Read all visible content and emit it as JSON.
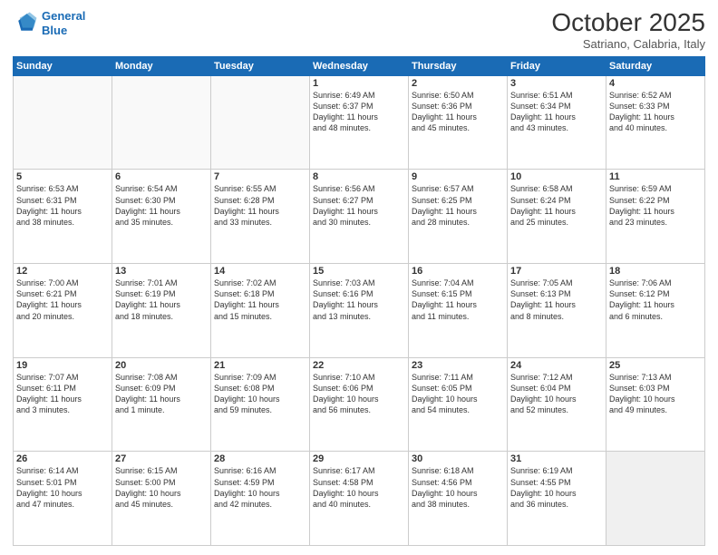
{
  "header": {
    "logo_line1": "General",
    "logo_line2": "Blue",
    "month": "October 2025",
    "location": "Satriano, Calabria, Italy"
  },
  "days_of_week": [
    "Sunday",
    "Monday",
    "Tuesday",
    "Wednesday",
    "Thursday",
    "Friday",
    "Saturday"
  ],
  "weeks": [
    [
      {
        "day": "",
        "info": ""
      },
      {
        "day": "",
        "info": ""
      },
      {
        "day": "",
        "info": ""
      },
      {
        "day": "1",
        "info": "Sunrise: 6:49 AM\nSunset: 6:37 PM\nDaylight: 11 hours\nand 48 minutes."
      },
      {
        "day": "2",
        "info": "Sunrise: 6:50 AM\nSunset: 6:36 PM\nDaylight: 11 hours\nand 45 minutes."
      },
      {
        "day": "3",
        "info": "Sunrise: 6:51 AM\nSunset: 6:34 PM\nDaylight: 11 hours\nand 43 minutes."
      },
      {
        "day": "4",
        "info": "Sunrise: 6:52 AM\nSunset: 6:33 PM\nDaylight: 11 hours\nand 40 minutes."
      }
    ],
    [
      {
        "day": "5",
        "info": "Sunrise: 6:53 AM\nSunset: 6:31 PM\nDaylight: 11 hours\nand 38 minutes."
      },
      {
        "day": "6",
        "info": "Sunrise: 6:54 AM\nSunset: 6:30 PM\nDaylight: 11 hours\nand 35 minutes."
      },
      {
        "day": "7",
        "info": "Sunrise: 6:55 AM\nSunset: 6:28 PM\nDaylight: 11 hours\nand 33 minutes."
      },
      {
        "day": "8",
        "info": "Sunrise: 6:56 AM\nSunset: 6:27 PM\nDaylight: 11 hours\nand 30 minutes."
      },
      {
        "day": "9",
        "info": "Sunrise: 6:57 AM\nSunset: 6:25 PM\nDaylight: 11 hours\nand 28 minutes."
      },
      {
        "day": "10",
        "info": "Sunrise: 6:58 AM\nSunset: 6:24 PM\nDaylight: 11 hours\nand 25 minutes."
      },
      {
        "day": "11",
        "info": "Sunrise: 6:59 AM\nSunset: 6:22 PM\nDaylight: 11 hours\nand 23 minutes."
      }
    ],
    [
      {
        "day": "12",
        "info": "Sunrise: 7:00 AM\nSunset: 6:21 PM\nDaylight: 11 hours\nand 20 minutes."
      },
      {
        "day": "13",
        "info": "Sunrise: 7:01 AM\nSunset: 6:19 PM\nDaylight: 11 hours\nand 18 minutes."
      },
      {
        "day": "14",
        "info": "Sunrise: 7:02 AM\nSunset: 6:18 PM\nDaylight: 11 hours\nand 15 minutes."
      },
      {
        "day": "15",
        "info": "Sunrise: 7:03 AM\nSunset: 6:16 PM\nDaylight: 11 hours\nand 13 minutes."
      },
      {
        "day": "16",
        "info": "Sunrise: 7:04 AM\nSunset: 6:15 PM\nDaylight: 11 hours\nand 11 minutes."
      },
      {
        "day": "17",
        "info": "Sunrise: 7:05 AM\nSunset: 6:13 PM\nDaylight: 11 hours\nand 8 minutes."
      },
      {
        "day": "18",
        "info": "Sunrise: 7:06 AM\nSunset: 6:12 PM\nDaylight: 11 hours\nand 6 minutes."
      }
    ],
    [
      {
        "day": "19",
        "info": "Sunrise: 7:07 AM\nSunset: 6:11 PM\nDaylight: 11 hours\nand 3 minutes."
      },
      {
        "day": "20",
        "info": "Sunrise: 7:08 AM\nSunset: 6:09 PM\nDaylight: 11 hours\nand 1 minute."
      },
      {
        "day": "21",
        "info": "Sunrise: 7:09 AM\nSunset: 6:08 PM\nDaylight: 10 hours\nand 59 minutes."
      },
      {
        "day": "22",
        "info": "Sunrise: 7:10 AM\nSunset: 6:06 PM\nDaylight: 10 hours\nand 56 minutes."
      },
      {
        "day": "23",
        "info": "Sunrise: 7:11 AM\nSunset: 6:05 PM\nDaylight: 10 hours\nand 54 minutes."
      },
      {
        "day": "24",
        "info": "Sunrise: 7:12 AM\nSunset: 6:04 PM\nDaylight: 10 hours\nand 52 minutes."
      },
      {
        "day": "25",
        "info": "Sunrise: 7:13 AM\nSunset: 6:03 PM\nDaylight: 10 hours\nand 49 minutes."
      }
    ],
    [
      {
        "day": "26",
        "info": "Sunrise: 6:14 AM\nSunset: 5:01 PM\nDaylight: 10 hours\nand 47 minutes."
      },
      {
        "day": "27",
        "info": "Sunrise: 6:15 AM\nSunset: 5:00 PM\nDaylight: 10 hours\nand 45 minutes."
      },
      {
        "day": "28",
        "info": "Sunrise: 6:16 AM\nSunset: 4:59 PM\nDaylight: 10 hours\nand 42 minutes."
      },
      {
        "day": "29",
        "info": "Sunrise: 6:17 AM\nSunset: 4:58 PM\nDaylight: 10 hours\nand 40 minutes."
      },
      {
        "day": "30",
        "info": "Sunrise: 6:18 AM\nSunset: 4:56 PM\nDaylight: 10 hours\nand 38 minutes."
      },
      {
        "day": "31",
        "info": "Sunrise: 6:19 AM\nSunset: 4:55 PM\nDaylight: 10 hours\nand 36 minutes."
      },
      {
        "day": "",
        "info": ""
      }
    ]
  ]
}
